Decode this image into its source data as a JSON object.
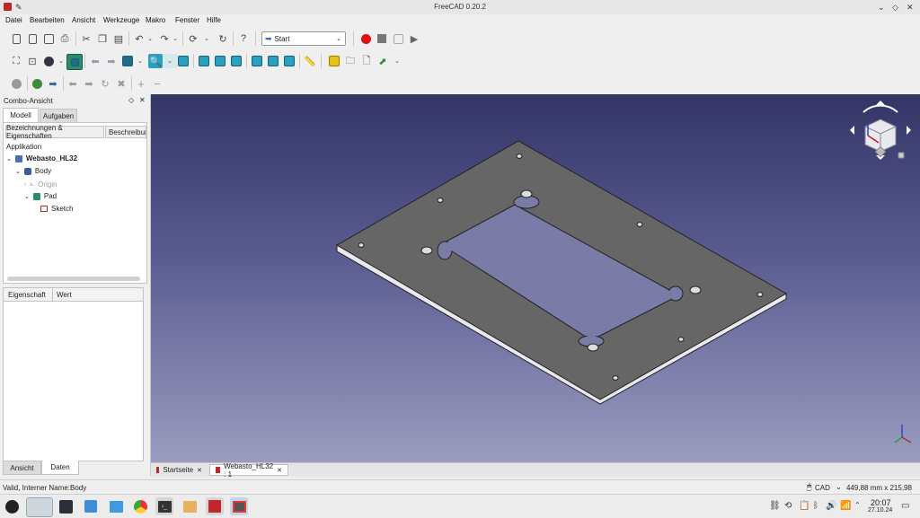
{
  "window": {
    "title": "FreeCAD 0.20.2"
  },
  "menu": [
    "Datei",
    "Bearbeiten",
    "Ansicht",
    "Werkzeuge",
    "Makro",
    "Fenster",
    "Hilfe"
  ],
  "toolbar": {
    "workbench": "Start"
  },
  "combo": {
    "title": "Combo-Ansicht",
    "tabs": [
      "Modell",
      "Aufgaben"
    ],
    "subtabs": [
      "Bezeichnungen & Eigenschaften",
      "Beschreibung"
    ],
    "tree_root": "Applikation",
    "tree": [
      {
        "label": "Webasto_HL32",
        "bold": true
      },
      {
        "label": "Body"
      },
      {
        "label": "Origin",
        "muted": true
      },
      {
        "label": "Pad"
      },
      {
        "label": "Sketch"
      }
    ],
    "property_columns": [
      "Eigenschaft",
      "Wert"
    ],
    "bottom_tabs": [
      "Ansicht",
      "Daten"
    ]
  },
  "doc_tabs": [
    "Startseite",
    "Webasto_HL32 : 1"
  ],
  "status": {
    "message": "Valid, Interner Name:Body",
    "nav_style": "CAD",
    "dimensions": "449,88 mm x 215,98 mm"
  },
  "taskbar": {
    "time": "20:07",
    "date": "27.10.24"
  },
  "colors": {
    "accent": "#2a9fbf",
    "plate": "#666666",
    "viewport_top": "#333466",
    "viewport_bottom": "#9b9cbf"
  }
}
